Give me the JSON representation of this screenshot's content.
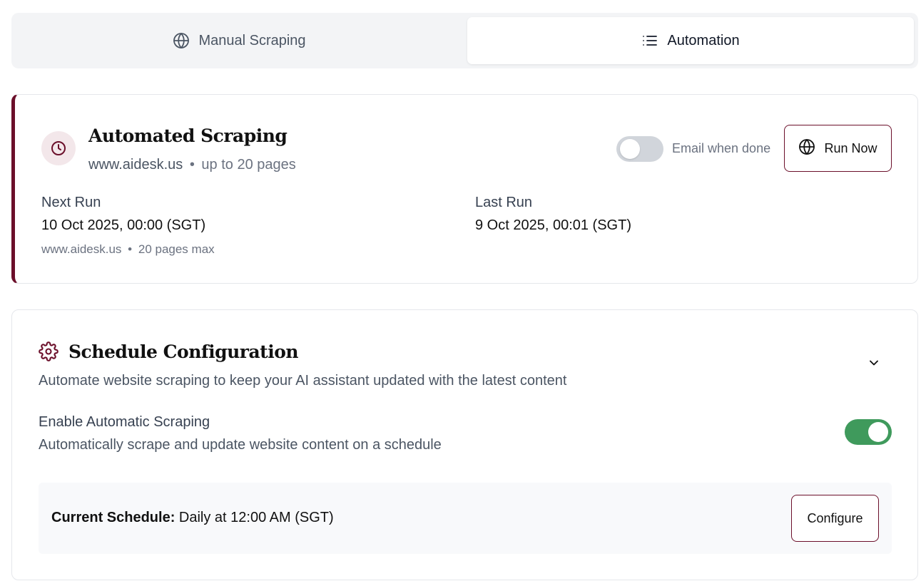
{
  "tabs": {
    "manual": "Manual Scraping",
    "automation": "Automation"
  },
  "status": {
    "title": "Automated Scraping",
    "site": "www.aidesk.us",
    "separator": "•",
    "pages": "up to 20 pages",
    "email_label": "Email when done",
    "email_enabled": false,
    "run_now": "Run Now",
    "next_run_label": "Next Run",
    "next_run_value": "10 Oct 2025, 00:00 (SGT)",
    "next_run_note_site": "www.aidesk.us",
    "next_run_note_pages": "20 pages max",
    "last_run_label": "Last Run",
    "last_run_value": "9 Oct 2025, 00:01 (SGT)"
  },
  "schedule": {
    "title": "Schedule Configuration",
    "description": "Automate website scraping to keep your AI assistant updated with the latest content",
    "enable_label": "Enable Automatic Scraping",
    "enable_desc": "Automatically scrape and update website content on a schedule",
    "enabled": true,
    "current_label": "Current Schedule:",
    "current_value": "Daily at 12:00 AM (SGT)",
    "configure": "Configure"
  },
  "colors": {
    "accent": "#6b0f2a",
    "toggle_on": "#3f9a5c",
    "toggle_off": "#d1d5db"
  },
  "icons": {
    "manual_tab": "globe-icon",
    "automation_tab": "list-icon",
    "status": "clock-icon",
    "run_now": "globe-icon",
    "schedule": "gear-icon",
    "collapse": "chevron-down-icon"
  }
}
